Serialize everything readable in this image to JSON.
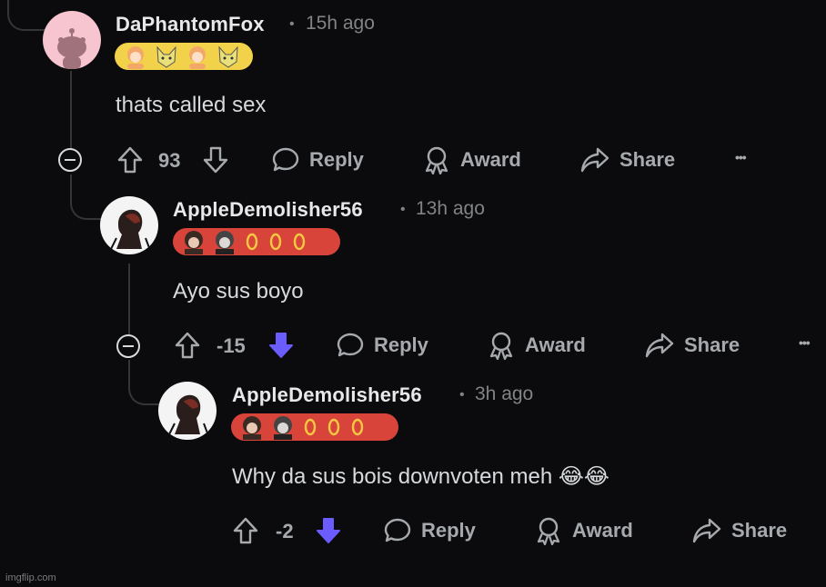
{
  "colors": {
    "background": "#0b0b0d",
    "downvote_active": "#6a5cff",
    "flair_yellow": "#f2d24a",
    "flair_red": "#d9443a"
  },
  "comments": [
    {
      "username": "DaPhantomFox",
      "separator": "•",
      "time": "15h ago",
      "body": "thats called sex",
      "score": "93",
      "downvoted": false,
      "avatar_icon": "reddit-snoo-icon"
    },
    {
      "username": "AppleDemolisher56",
      "separator": "•",
      "time": "13h ago",
      "body": "Ayo sus boyo",
      "score": "-15",
      "downvoted": true,
      "avatar_icon": "user-avatar-icon"
    },
    {
      "username": "AppleDemolisher56",
      "separator": "•",
      "time": "3h ago",
      "body": "Why da sus bois downvoten meh 😂😂",
      "score": "-2",
      "downvoted": true,
      "avatar_icon": "user-avatar-icon"
    }
  ],
  "actions": {
    "reply": "Reply",
    "award": "Award",
    "share": "Share",
    "more": "•••"
  },
  "watermark": "imgflip.com"
}
